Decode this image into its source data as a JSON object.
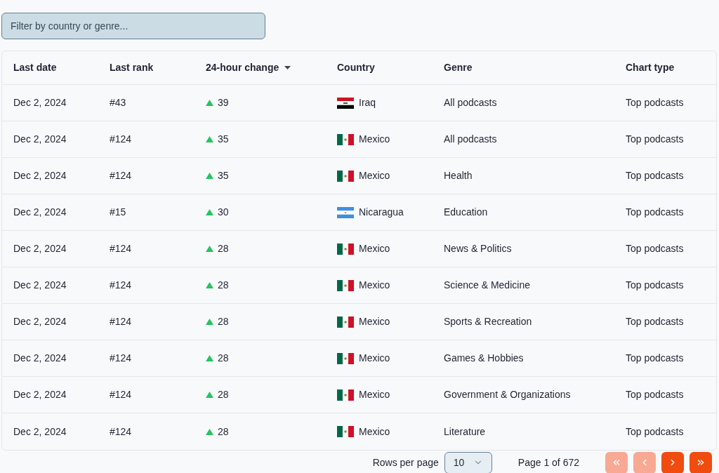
{
  "filter": {
    "placeholder": "Filter by country or genre..."
  },
  "table": {
    "columns": [
      {
        "label": "Last date",
        "sorted": false
      },
      {
        "label": "Last rank",
        "sorted": false
      },
      {
        "label": "24-hour change",
        "sorted": true
      },
      {
        "label": "Country",
        "sorted": false
      },
      {
        "label": "Genre",
        "sorted": false
      },
      {
        "label": "Chart type",
        "sorted": false
      }
    ],
    "rows": [
      {
        "kind": "iraq",
        "date": "Dec 2, 2024",
        "rank": "#43",
        "rising": true,
        "change": "39",
        "country": "Iraq",
        "genre": "All podcasts",
        "chart_type": "Top podcasts"
      },
      {
        "kind": "mexico",
        "date": "Dec 2, 2024",
        "rank": "#124",
        "rising": true,
        "change": "35",
        "country": "Mexico",
        "genre": "All podcasts",
        "chart_type": "Top podcasts"
      },
      {
        "kind": "mexico",
        "date": "Dec 2, 2024",
        "rank": "#124",
        "rising": true,
        "change": "35",
        "country": "Mexico",
        "genre": "Health",
        "chart_type": "Top podcasts"
      },
      {
        "kind": "nicaragua",
        "date": "Dec 2, 2024",
        "rank": "#15",
        "rising": true,
        "change": "30",
        "country": "Nicaragua",
        "genre": "Education",
        "chart_type": "Top podcasts"
      },
      {
        "kind": "mexico",
        "date": "Dec 2, 2024",
        "rank": "#124",
        "rising": true,
        "change": "28",
        "country": "Mexico",
        "genre": "News & Politics",
        "chart_type": "Top podcasts"
      },
      {
        "kind": "mexico",
        "date": "Dec 2, 2024",
        "rank": "#124",
        "rising": true,
        "change": "28",
        "country": "Mexico",
        "genre": "Science & Medicine",
        "chart_type": "Top podcasts"
      },
      {
        "kind": "mexico",
        "date": "Dec 2, 2024",
        "rank": "#124",
        "rising": true,
        "change": "28",
        "country": "Mexico",
        "genre": "Sports & Recreation",
        "chart_type": "Top podcasts"
      },
      {
        "kind": "mexico",
        "date": "Dec 2, 2024",
        "rank": "#124",
        "rising": true,
        "change": "28",
        "country": "Mexico",
        "genre": "Games & Hobbies",
        "chart_type": "Top podcasts"
      },
      {
        "kind": "mexico",
        "date": "Dec 2, 2024",
        "rank": "#124",
        "rising": true,
        "change": "28",
        "country": "Mexico",
        "genre": "Government & Organizations",
        "chart_type": "Top podcasts"
      },
      {
        "kind": "mexico",
        "date": "Dec 2, 2024",
        "rank": "#124",
        "rising": true,
        "change": "28",
        "country": "Mexico",
        "genre": "Literature",
        "chart_type": "Top podcasts"
      }
    ]
  },
  "pagination": {
    "rows_label": "Rows per page",
    "rows_value": "10",
    "page_label": "Page 1 of 672",
    "buttons": [
      {
        "kind": "first",
        "disabled": true
      },
      {
        "kind": "prev",
        "disabled": true
      },
      {
        "kind": "next",
        "disabled": false
      },
      {
        "kind": "last",
        "disabled": false
      }
    ]
  }
}
